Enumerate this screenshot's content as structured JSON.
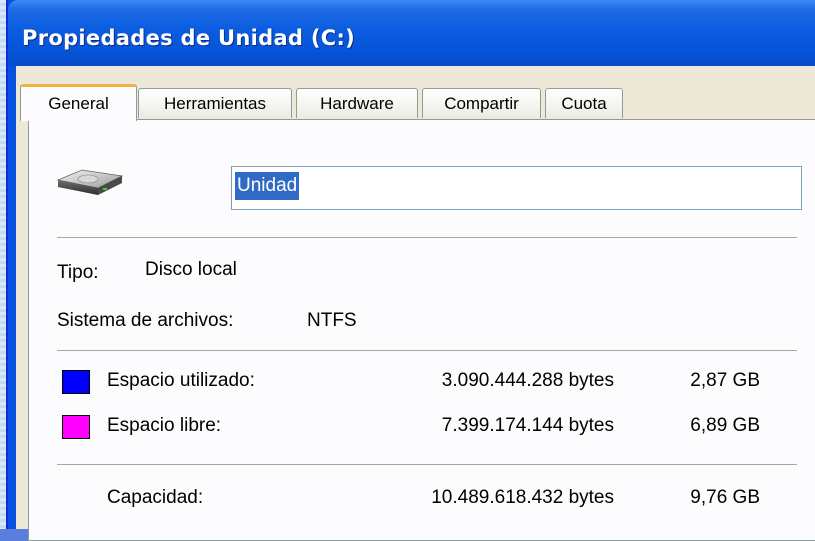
{
  "window": {
    "title": "Propiedades de Unidad (C:)"
  },
  "tabs": [
    {
      "label": "General",
      "active": true
    },
    {
      "label": "Herramientas"
    },
    {
      "label": "Hardware"
    },
    {
      "label": "Compartir"
    },
    {
      "label": "Cuota"
    }
  ],
  "general": {
    "drive_icon": "hard-drive-icon",
    "name_value": "Unidad",
    "tipo_label": "Tipo:",
    "tipo_value": "Disco local",
    "fs_label": "Sistema de archivos:",
    "fs_value": "NTFS",
    "used": {
      "label": "Espacio utilizado:",
      "bytes": "3.090.444.288 bytes",
      "size": "2,87 GB",
      "color": "#0000ff"
    },
    "free": {
      "label": "Espacio libre:",
      "bytes": "7.399.174.144 bytes",
      "size": "6,89 GB",
      "color": "#ff00ff"
    },
    "capacity": {
      "label": "Capacidad:",
      "bytes": "10.489.618.432 bytes",
      "size": "9,76 GB"
    }
  }
}
